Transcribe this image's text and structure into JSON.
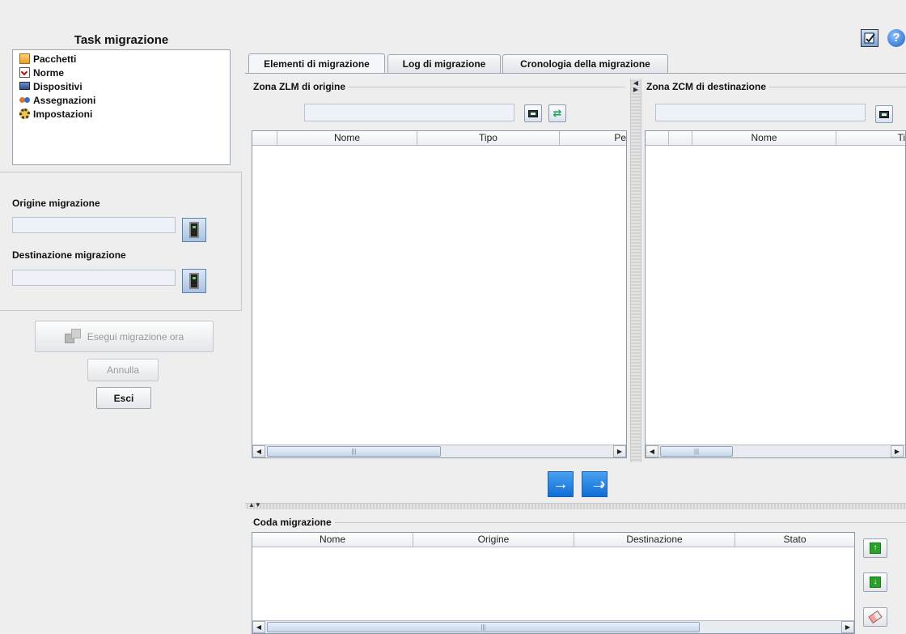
{
  "left": {
    "title": "Task migrazione",
    "tree": [
      {
        "label": "Pacchetti",
        "icon": "package-icon"
      },
      {
        "label": "Norme",
        "icon": "policy-icon"
      },
      {
        "label": "Dispositivi",
        "icon": "device-icon"
      },
      {
        "label": "Assegnazioni",
        "icon": "assignment-icon"
      },
      {
        "label": "Impostazioni",
        "icon": "settings-icon"
      }
    ],
    "source_label": "Origine migrazione",
    "dest_label": "Destinazione migrazione",
    "run_button": "Esegui migrazione ora",
    "cancel_button": "Annulla",
    "exit_button": "Esci"
  },
  "tabs": [
    "Elementi di migrazione",
    "Log di migrazione",
    "Cronologia della migrazione"
  ],
  "source_zone": {
    "title": "Zona ZLM di origine",
    "columns": [
      "",
      "Nome",
      "Tipo",
      "Pe"
    ]
  },
  "dest_zone": {
    "title": "Zona ZCM di destinazione",
    "columns": [
      "",
      "",
      "Nome",
      "Ti"
    ]
  },
  "queue": {
    "title": "Coda migrazione",
    "columns": [
      "Nome",
      "Origine",
      "Destinazione",
      "Stato"
    ]
  },
  "colors": {
    "accent": "#1a73d9",
    "panel": "#eeeeee"
  }
}
